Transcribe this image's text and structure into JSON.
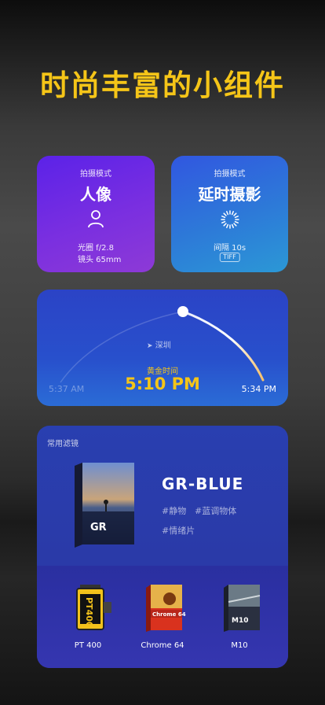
{
  "headline": "时尚丰富的小组件",
  "portrait_card": {
    "label": "拍摄模式",
    "title": "人像",
    "icon": "person-icon",
    "aperture": "光圈 f/2.8",
    "lens": "镜头 65mm",
    "gradient": [
      "#5b22e8",
      "#8d3ad6"
    ]
  },
  "timelapse_card": {
    "label": "拍摄模式",
    "title": "延时摄影",
    "icon": "timelapse-icon",
    "interval": "间隔 10s",
    "format": "TIFF",
    "gradient": [
      "#3157e0",
      "#2b98d6"
    ]
  },
  "golden_hour_card": {
    "location": "深圳",
    "label": "黄金时间",
    "time": "5:10 PM",
    "start_time": "5:37 AM",
    "end_time": "5:34 PM",
    "accent": "#f5c518"
  },
  "filters_card": {
    "title": "常用滤镜",
    "featured": {
      "name": "GR-BLUE",
      "box_letters": "GR",
      "tags": [
        "#静物",
        "#蓝调物体",
        "#情绪片"
      ]
    },
    "items": [
      {
        "label": "PT 400",
        "box_text": "PT400"
      },
      {
        "label": "Chrome 64",
        "box_text": "Chrome 64"
      },
      {
        "label": "M10",
        "box_text": "M10"
      }
    ]
  }
}
